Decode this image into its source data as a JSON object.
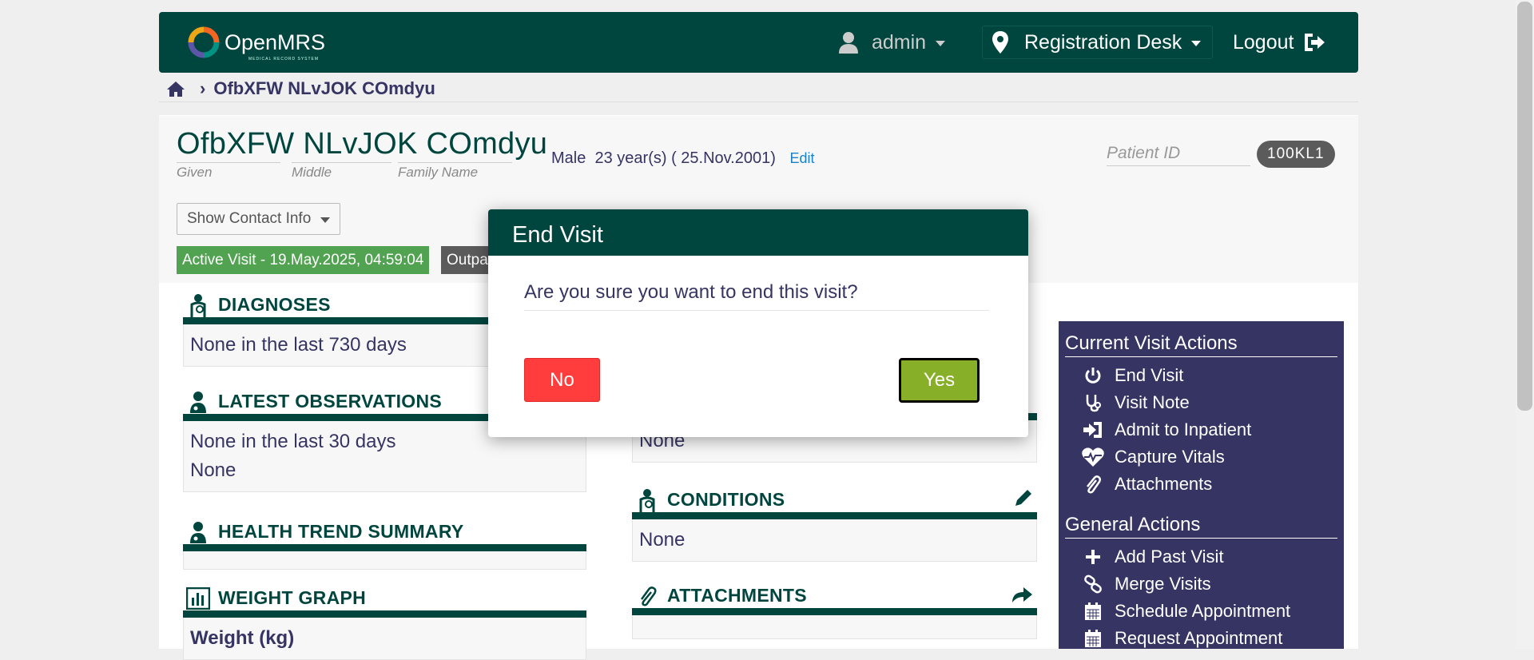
{
  "header": {
    "logo_text": "OpenMRS",
    "logo_sub": "MEDICAL RECORD SYSTEM",
    "user": "admin",
    "location": "Registration Desk",
    "logout": "Logout"
  },
  "breadcrumb": {
    "patient": "OfbXFW NLvJOK COmdyu"
  },
  "patient": {
    "name": "OfbXFW NLvJOK COmdyu",
    "given_label": "Given",
    "middle_label": "Middle",
    "family_label": "Family Name",
    "gender": "Male",
    "age": "23 year(s) ( 25.Nov.2001)",
    "edit": "Edit",
    "id_label": "Patient ID",
    "id": "100KL1",
    "contact_btn": "Show Contact Info",
    "active_visit": "Active Visit - 19.May.2025, 04:59:04",
    "visit_type": "Outpatient"
  },
  "sections": {
    "diagnoses": {
      "title": "DIAGNOSES",
      "body": "None in the last 730 days"
    },
    "observations": {
      "title": "LATEST OBSERVATIONS",
      "body1": "None in the last 30 days",
      "body2": "None"
    },
    "trend": {
      "title": "HEALTH TREND SUMMARY"
    },
    "weight": {
      "title": "WEIGHT GRAPH",
      "body": "Weight (kg)"
    },
    "unknown": {
      "body": "None"
    },
    "conditions": {
      "title": "CONDITIONS",
      "body": "None"
    },
    "attachments": {
      "title": "ATTACHMENTS"
    }
  },
  "sidebar": {
    "current_title": "Current Visit Actions",
    "current": [
      {
        "label": "End Visit",
        "icon": "power-icon"
      },
      {
        "label": "Visit Note",
        "icon": "stethoscope-icon"
      },
      {
        "label": "Admit to Inpatient",
        "icon": "sign-in-icon"
      },
      {
        "label": "Capture Vitals",
        "icon": "heartbeat-icon"
      },
      {
        "label": "Attachments",
        "icon": "paperclip-icon"
      }
    ],
    "general_title": "General Actions",
    "general": [
      {
        "label": "Add Past Visit",
        "icon": "plus-icon"
      },
      {
        "label": "Merge Visits",
        "icon": "link-icon"
      },
      {
        "label": "Schedule Appointment",
        "icon": "calendar-icon"
      },
      {
        "label": "Request Appointment",
        "icon": "calendar-icon"
      }
    ]
  },
  "modal": {
    "title": "End Visit",
    "question": "Are you sure you want to end this visit?",
    "no": "No",
    "yes": "Yes"
  }
}
